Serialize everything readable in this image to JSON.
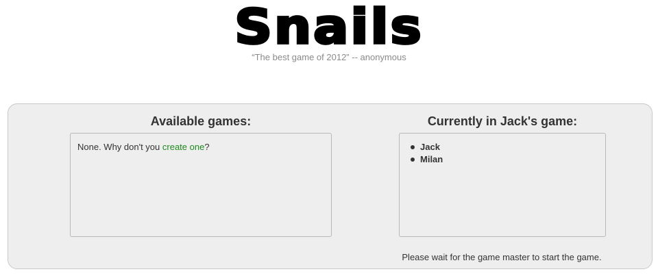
{
  "header": {
    "logo": "Snails",
    "tagline": "“The best game of 2012” -- anonymous"
  },
  "games": {
    "title": "Available games:",
    "empty_prefix": "None. Why don't you ",
    "create_link": "create one",
    "empty_suffix": "?"
  },
  "lobby": {
    "title": "Currently in Jack's game:",
    "players": [
      "Jack",
      "Milan"
    ],
    "wait_message": "Please wait for the game master to start the game."
  },
  "colors": {
    "panel_bg": "#eeeeee",
    "link": "#1e8a1e",
    "tagline": "#8a8a8a"
  }
}
